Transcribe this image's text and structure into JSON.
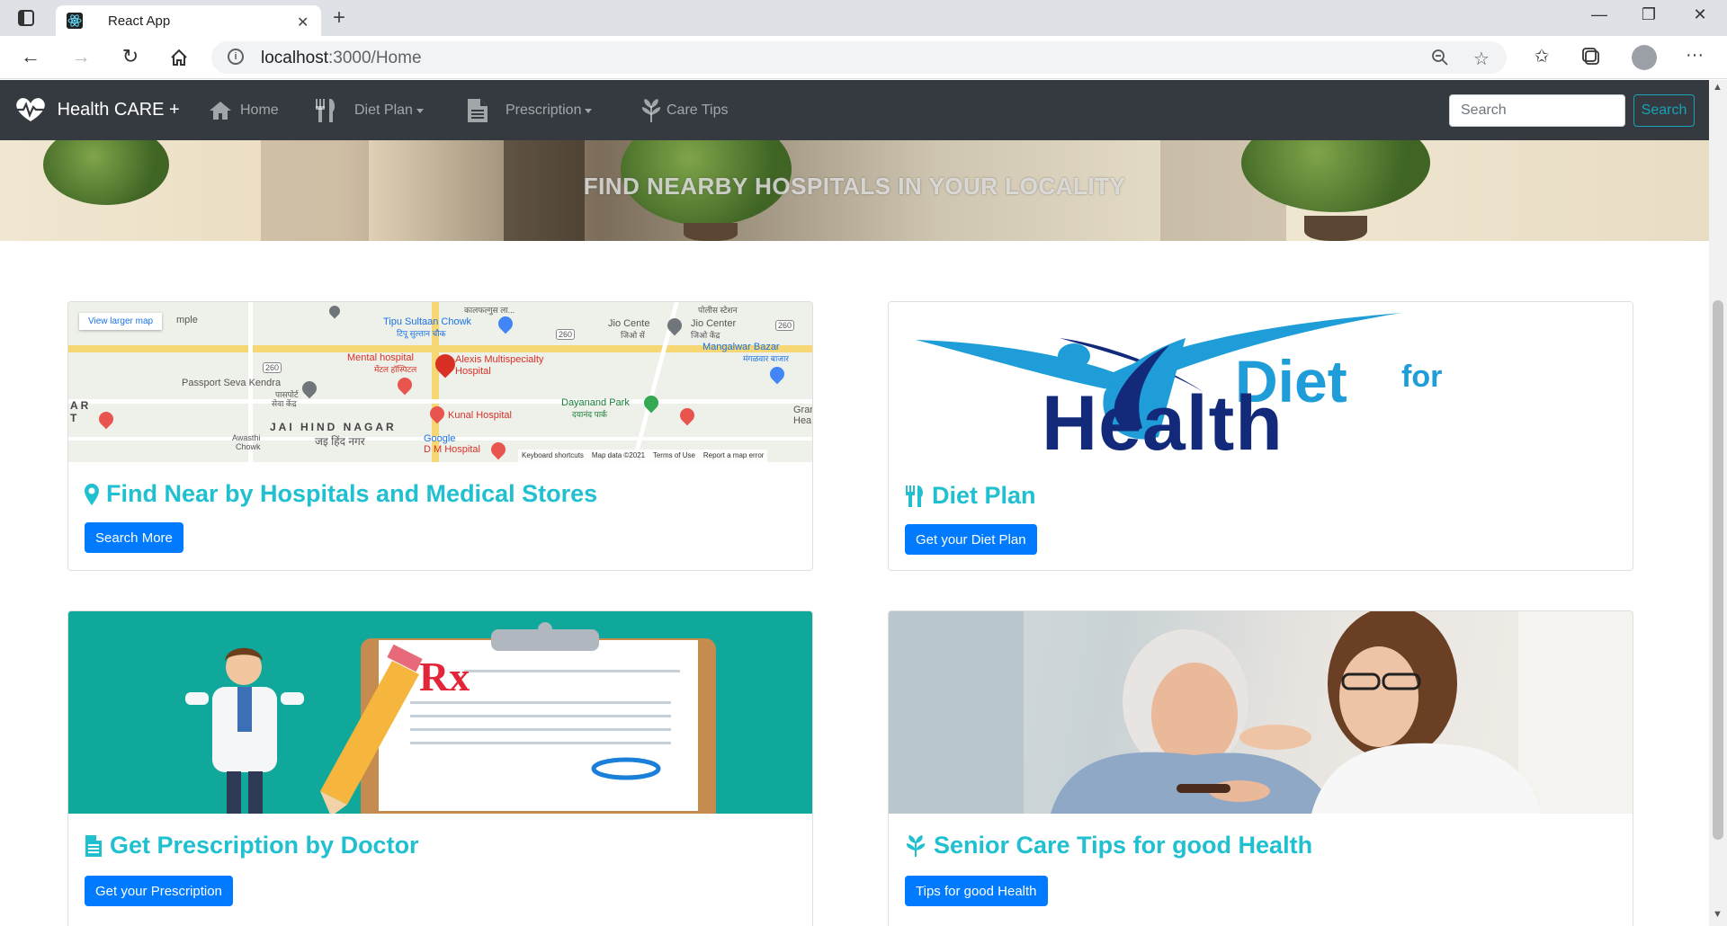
{
  "browser": {
    "tab_title": "React App",
    "url_host": "localhost",
    "url_path": ":3000/Home"
  },
  "navbar": {
    "brand": "Health CARE +",
    "items": [
      {
        "label": "Home",
        "icon": "home-icon"
      },
      {
        "label": "Diet Plan",
        "icon": "utensils-icon",
        "dropdown": true
      },
      {
        "label": "Prescription",
        "icon": "file-icon",
        "dropdown": true
      },
      {
        "label": "Care Tips",
        "icon": "leaf-icon"
      }
    ],
    "search_placeholder": "Search",
    "search_button": "Search",
    "bg_color": "#343a40"
  },
  "banner": {
    "text": "FIND NEARBY HOSPITALS IN YOUR LOCALITY"
  },
  "map": {
    "view_larger": "View larger map",
    "labels": {
      "mple": "mple",
      "tipu": "Tipu Sultaan Chowk",
      "tipu_hi": "टिपू सुल्तान चौक",
      "kalpan": "कालफल्गुस ला...",
      "police": "पोलीस स्टेशन",
      "jio1": "Jio Cente",
      "jio1_hi": "जिओ सें",
      "jio2": "Jio Center",
      "jio2_hi": "जिओ केंद्र",
      "mangalwar": "Mangalwar Bazar",
      "mangalwar_hi": "मंगळवार बाजार",
      "mental": "Mental hospital",
      "mental_hi": "मेंटल हॉस्पिटल",
      "alexis1": "Alexis Multispecialty",
      "alexis2": "Hospital",
      "passport": "Passport Seva Kendra",
      "passport_hi1": "पासपोर्ट",
      "passport_hi2": "सेवा केंद्र",
      "dayanand": "Dayanand Park",
      "dayanand_hi": "दयानंद पार्क",
      "ar": "AR",
      "t": "T",
      "gran": "Gran",
      "hea": "Hea",
      "kunal": "Kunal Hospital",
      "jaihind": "JAI HIND NAGAR",
      "jaihind_hi": "जइ हिंद नगर",
      "awasthi": "Awasthi",
      "chowk": "Chowk",
      "google": "Google",
      "dm": "D M Hospital",
      "road_260": "260",
      "keyboard": "Keyboard shortcuts",
      "mapdata": "Map data ©2021",
      "terms": "Terms of Use",
      "report": "Report a map error"
    }
  },
  "cards": [
    {
      "title": "Find Near by Hospitals and Medical Stores",
      "button": "Search More",
      "icon": "map-marker-icon"
    },
    {
      "title": "Diet Plan",
      "button": "Get your Diet Plan",
      "icon": "utensils-icon",
      "logo_line1": "Diet",
      "logo_for": "for",
      "logo_line2": "Health"
    },
    {
      "title": "Get Prescription by Doctor",
      "button": "Get your Prescription",
      "icon": "file-icon",
      "rx": "Rx"
    },
    {
      "title": "Senior Care Tips for good Health",
      "button": "Tips for good Health",
      "icon": "leaf-icon"
    }
  ],
  "colors": {
    "title": "#20c0d0",
    "primary": "#007bff",
    "info": "#17a2b8"
  }
}
